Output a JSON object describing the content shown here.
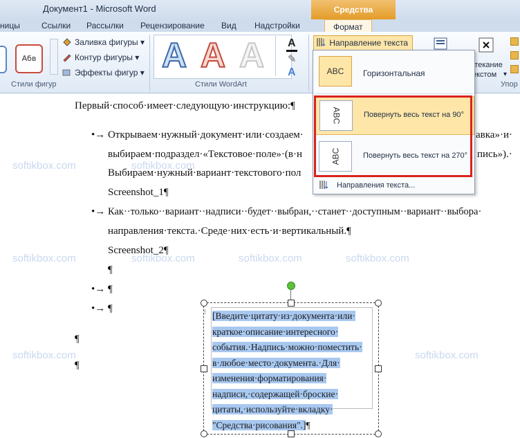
{
  "window": {
    "title": "Документ1  -  Microsoft Word"
  },
  "contextual_tab": {
    "header": "Средства рисования",
    "tab": "Формат"
  },
  "tabs": [
    "ницы",
    "Ссылки",
    "Рассылки",
    "Рецензирование",
    "Вид",
    "Надстройки"
  ],
  "ribbon": {
    "shape_styles": {
      "sample_label": "Абв",
      "fill_label": "Заливка фигуры",
      "outline_label": "Контур фигуры",
      "effects_label": "Эффекты фигур",
      "group_label": "Стили фигур"
    },
    "wordart": {
      "letters": [
        "A",
        "A",
        "A"
      ],
      "group_label": "Стили WordArt"
    },
    "text_direction_label": "Направление текста",
    "wrap_label_1": "бтекание",
    "wrap_label_2": "екстом",
    "arrange_group_label": "Упор"
  },
  "dropdown": {
    "items": [
      {
        "sample": "ABC",
        "label": "Горизонтальная"
      },
      {
        "sample": "ABC",
        "label": "Повернуть весь текст на 90°"
      },
      {
        "sample": "ABC",
        "label": "Повернуть весь текст на 270°"
      }
    ],
    "more_label": "Направления текста..."
  },
  "document": {
    "line1": "Первый·способ·имеет·следующую·инструкцию:¶",
    "bullet1_l1": "Открываем·нужный·документ·или·создаем·",
    "bullet1_l1_end": "авка»·и·",
    "bullet1_l2": "выбираем·подраздел·«Текстовое·поле»·(в·н",
    "bullet1_l2_end": "пись»).·",
    "bullet1_l3": "Выбираем·нужный·вариант·текстового·пол",
    "screenshot1": "Screenshot_1¶",
    "bullet2_l1": "Как··только··вариант··надписи··будет··выбран,··станет··доступным··вариант··выбора·",
    "bullet2_l2": "направления·текста.·Среде·них·есть·и·вертикальный.¶",
    "screenshot2": "Screenshot_2¶",
    "pilcrow": "¶",
    "bullet_marker": "•→",
    "textbox_lines": [
      "[Введите·цитату·из·документа·или·",
      "краткое·описание·интересного·",
      "события.·Надпись·можно·поместить·",
      "в·любое·место·документа.·Для·",
      "изменения·форматирования·",
      "надписи,·содержащей·броские·",
      "цитаты,·используйте·вкладку·",
      "\"Средства·рисования\".]"
    ]
  },
  "watermark": "softikbox.com",
  "colors": {
    "accent_orange": "#e39c28",
    "highlight": "#fde6a8",
    "selection": "#a8c8f0",
    "red_frame": "#d9221c"
  }
}
